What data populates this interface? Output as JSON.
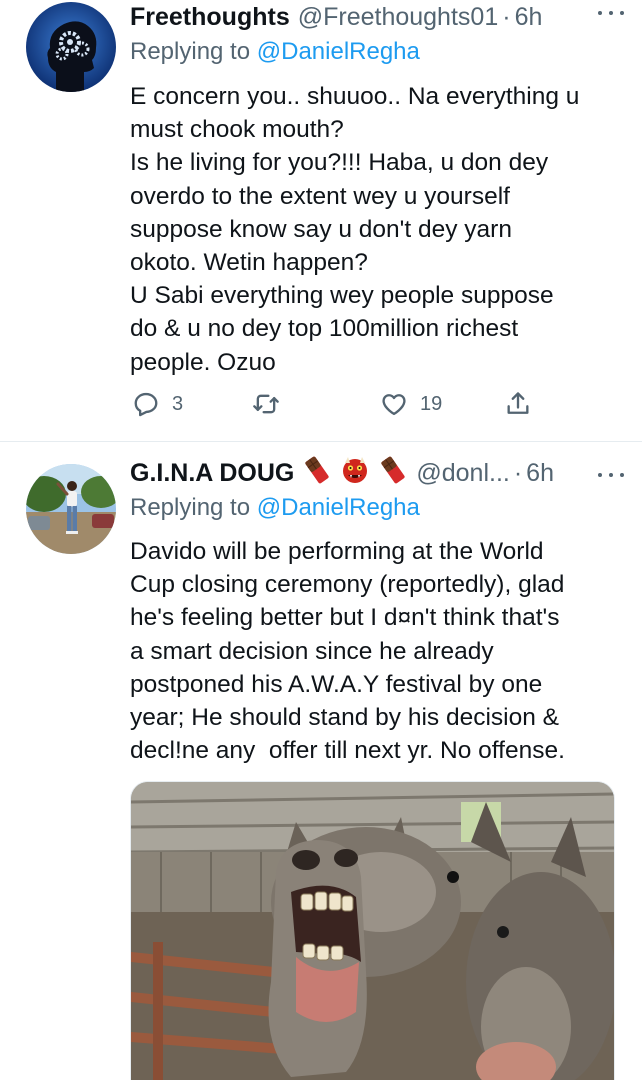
{
  "tweets": [
    {
      "author": {
        "display_name": "Freethoughts",
        "handle": "@Freethoughts01"
      },
      "dot": "·",
      "time": "6h",
      "reply_prefix": "Replying to ",
      "reply_to": "@DanielRegha",
      "text": "E concern you.. shuuoo.. Na everything u\nmust chook mouth?\nIs he living for you?!!! Haba, u don dey\noverdo to the extent wey u yourself\nsuppose know say u don't dey yarn\nokoto. Wetin happen?\nU Sabi everything wey people suppose\ndo & u no dey top 100million richest\npeople. Ozuo",
      "actions": {
        "reply_count": "3",
        "retweet_count": "",
        "like_count": "19"
      }
    },
    {
      "author": {
        "display_name": "G.I.N.A DOUG",
        "handle": "@donl..."
      },
      "dot": "·",
      "time": "6h",
      "emojis": [
        "chocolate-bar",
        "ogre",
        "chocolate-bar"
      ],
      "reply_prefix": "Replying to ",
      "reply_to": "@DanielRegha",
      "text": "Davido will be performing at the World\nCup closing ceremony (reportedly), glad\nhe's feeling better but I d¤n't think that's\na smart decision since he already\npostponed his A.W.A.Y festival by one\nyear; He should stand by his decision &\ndecl!ne any  offer till next yr. No offense.",
      "media": {
        "description": "laughing-donkey-photo"
      }
    }
  ],
  "colors": {
    "text": "#0f1419",
    "secondary": "#536471",
    "link": "#1d9bf0",
    "divider": "#e6ecf0"
  },
  "icons": [
    "more-icon",
    "reply-icon",
    "retweet-icon",
    "like-icon",
    "share-icon"
  ]
}
